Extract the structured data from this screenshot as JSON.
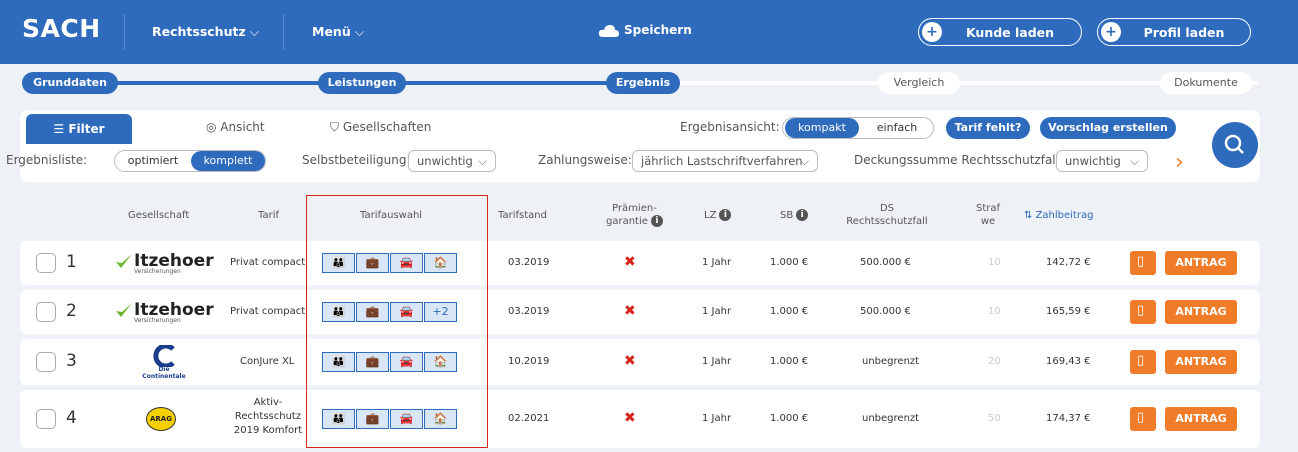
{
  "app": {
    "logo": "SACH"
  },
  "topnav": {
    "rechtsschutz": "Rechtsschutz",
    "menu": "Menü",
    "save": "Speichern",
    "kunde_laden": "Kunde laden",
    "profil_laden": "Profil laden"
  },
  "steps": [
    "Grunddaten",
    "Leistungen",
    "Ergebnis",
    "Vergleich",
    "Dokumente"
  ],
  "tabs": {
    "filter": "Filter",
    "ansicht": "Ansicht",
    "gesellschaften": "Gesellschaften"
  },
  "ergebnisansicht": {
    "label": "Ergebnisansicht:",
    "opt1": "kompakt",
    "opt2": "einfach"
  },
  "buttons": {
    "tarif_fehlt": "Tarif fehlt?",
    "vorschlag": "Vorschlag erstellen"
  },
  "filters": {
    "ergebnisliste_label": "Ergebnisliste:",
    "ergebnisliste_opt1": "optimiert",
    "ergebnisliste_opt2": "komplett",
    "sb_label": "Selbstbeteiligung:",
    "sb_value": "unwichtig",
    "zw_label": "Zahlungsweise:",
    "zw_value": "jährlich Lastschriftverfahren",
    "ds_label": "Deckungssumme Rechtsschutzfall:",
    "ds_value": "unwichtig"
  },
  "columns": {
    "gesellschaft": "Gesellschaft",
    "tarif": "Tarif",
    "tarifauswahl": "Tarifauswahl",
    "tarifstand": "Tarifstand",
    "praemien1": "Prämien-",
    "praemien2": "garantie",
    "lz": "LZ",
    "sb": "SB",
    "ds1": "DS",
    "ds2": "Rechtsschutzfall",
    "straf1": "Straf",
    "straf2": "we",
    "zahlbeitrag": "Zahlbeitrag"
  },
  "rows": [
    {
      "num": "1",
      "company": "Itzehoer",
      "company_sub": "Versicherungen",
      "tarif": "Privat compact",
      "extra": "",
      "tarifstand": "03.2019",
      "lz": "1 Jahr",
      "sb": "1.000 €",
      "ds": "500.000 €",
      "straf": "10",
      "beitrag": "142,72 €",
      "antrag": "ANTRAG"
    },
    {
      "num": "2",
      "company": "Itzehoer",
      "company_sub": "Versicherungen",
      "tarif": "Privat compact",
      "extra": "+2",
      "tarifstand": "03.2019",
      "lz": "1 Jahr",
      "sb": "1.000 €",
      "ds": "500.000 €",
      "straf": "10",
      "beitrag": "165,59 €",
      "antrag": "ANTRAG"
    },
    {
      "num": "3",
      "company": "Die Continentale",
      "company_sub": "",
      "tarif": "ConJure XL",
      "extra": "",
      "tarifstand": "10.2019",
      "lz": "1 Jahr",
      "sb": "1.000 €",
      "ds": "unbegrenzt",
      "straf": "20",
      "beitrag": "169,43 €",
      "antrag": "ANTRAG"
    },
    {
      "num": "4",
      "company": "ARAG",
      "company_sub": "",
      "tarif1": "Aktiv-",
      "tarif2": "Rechtsschutz",
      "tarif3": "2019 Komfort",
      "extra": "",
      "tarifstand": "02.2021",
      "lz": "1 Jahr",
      "sb": "1.000 €",
      "ds": "unbegrenzt",
      "straf": "50",
      "beitrag": "174,37 €",
      "antrag": "ANTRAG"
    }
  ],
  "colors": {
    "primary": "#2f6bbd",
    "accent": "#f07c2a",
    "danger": "#d9241b"
  }
}
